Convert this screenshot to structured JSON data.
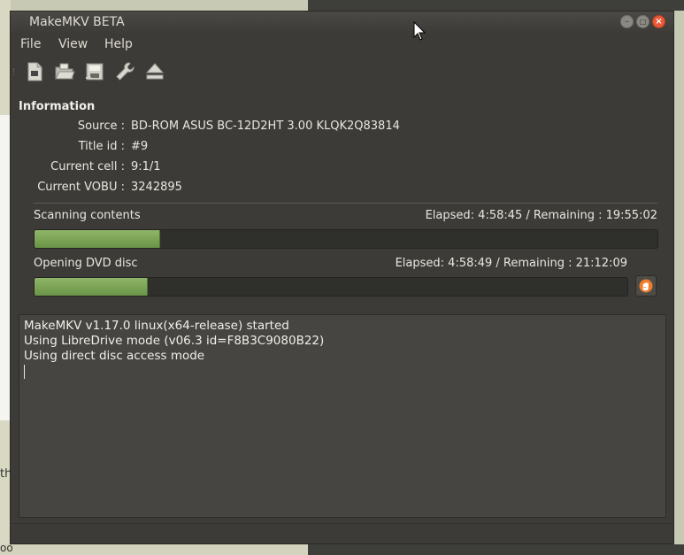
{
  "window": {
    "title": "MakeMKV BETA"
  },
  "menu": {
    "items": [
      "File",
      "View",
      "Help"
    ]
  },
  "toolbar": {
    "icons": [
      "open-file-icon",
      "open-folder-icon",
      "backup-icon",
      "wrench-icon",
      "eject-icon"
    ]
  },
  "info": {
    "heading": "Information",
    "rows": [
      {
        "label": "Source :",
        "value": "BD-ROM ASUS BC-12D2HT 3.00 KLQK2Q83814"
      },
      {
        "label": "Title id :",
        "value": "#9"
      },
      {
        "label": "Current cell :",
        "value": "9:1/1"
      },
      {
        "label": "Current VOBU :",
        "value": "3242895"
      }
    ]
  },
  "progress": [
    {
      "label": "Scanning contents",
      "time": "Elapsed: 4:58:45 / Remaining : 19:55:02",
      "fraction": 0.2
    },
    {
      "label": "Opening DVD disc",
      "time": "Elapsed: 4:58:49 / Remaining : 21:12:09",
      "fraction": 0.19
    }
  ],
  "log": {
    "lines": [
      "MakeMKV v1.17.0 linux(x64-release) started",
      "Using LibreDrive mode (v06.3 id=F8B3C9080B22)",
      "Using direct disc access mode"
    ]
  },
  "background": {
    "left_text": "th",
    "bottom_text": "oo"
  },
  "colors": {
    "progress_fill": "#7aa653",
    "close_button": "#e9593a",
    "stop_button_icon": "#f07b2c"
  }
}
